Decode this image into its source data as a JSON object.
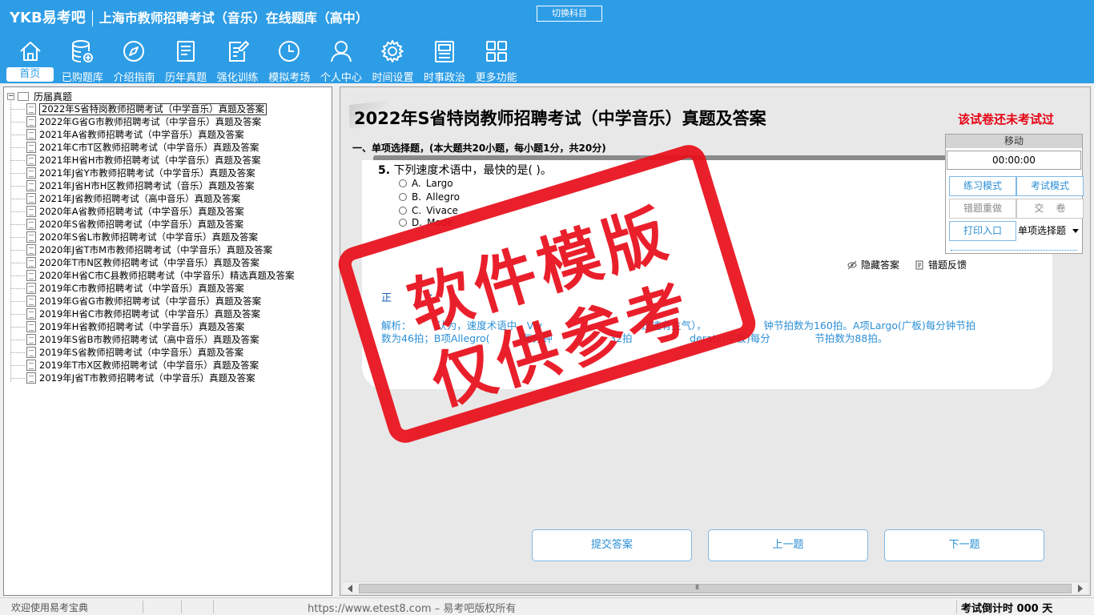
{
  "app": {
    "logo": "YKB易考吧",
    "title": "上海市教师招聘考试（音乐）在线题库（高中）",
    "switch_subject": "切换科目"
  },
  "nav": {
    "items": [
      {
        "label": "首页",
        "icon": "home-icon"
      },
      {
        "label": "已购题库",
        "icon": "database-icon"
      },
      {
        "label": "介绍指南",
        "icon": "compass-icon"
      },
      {
        "label": "历年真题",
        "icon": "document-list-icon"
      },
      {
        "label": "强化训练",
        "icon": "edit-document-icon"
      },
      {
        "label": "模拟考场",
        "icon": "clock-icon"
      },
      {
        "label": "个人中心",
        "icon": "user-icon"
      },
      {
        "label": "时间设置",
        "icon": "gear-icon"
      },
      {
        "label": "时事政治",
        "icon": "news-icon"
      },
      {
        "label": "更多功能",
        "icon": "grid-icon"
      }
    ]
  },
  "tree": {
    "root": "历届真题",
    "items": [
      "2022年S省特岗教师招聘考试（中学音乐）真题及答案",
      "2022年G省G市教师招聘考试（中学音乐）真题及答案",
      "2021年A省教师招聘考试（中学音乐）真题及答案",
      "2021年C市T区教师招聘考试（中学音乐）真题及答案",
      "2021年H省H市教师招聘考试（中学音乐）真题及答案",
      "2021年J省Y市教师招聘考试（中学音乐）真题及答案",
      "2021年J省H市H区教师招聘考试（音乐）真题及答案",
      "2021年J省教师招聘考试（高中音乐）真题及答案",
      "2020年A省教师招聘考试（中学音乐）真题及答案",
      "2020年S省教师招聘考试（中学音乐）真题及答案",
      "2020年S省L市教师招聘考试（中学音乐）真题及答案",
      "2020年J省T市M市教师招聘考试（中学音乐）真题及答案",
      "2020年T市N区教师招聘考试（中学音乐）真题及答案",
      "2020年H省C市C县教师招聘考试（中学音乐）精选真题及答案",
      "2019年C市教师招聘考试（中学音乐）真题及答案",
      "2019年G省G市教师招聘考试（中学音乐）真题及答案",
      "2019年H省C市教师招聘考试（中学音乐）真题及答案",
      "2019年H省教师招聘考试（中学音乐）真题及答案",
      "2019年S省B市教师招聘考试（高中音乐）真题及答案",
      "2019年S省教师招聘考试（中学音乐）真题及答案",
      "2019年T市X区教师招聘考试（中学音乐）真题及答案",
      "2019年J省T市教师招聘考试（中学音乐）真题及答案"
    ],
    "selected_index": 0
  },
  "paper": {
    "title": "2022年S省特岗教师招聘考试（中学音乐）真题及答案",
    "status": "该试卷还未考试过",
    "section": "一、单项选择题，(本大题共20小题，每小题1分，共20分)"
  },
  "question": {
    "number": "5.",
    "stem": "下列速度术语中，最快的是(  )。",
    "options": [
      {
        "letter": "A.",
        "text": "Largo"
      },
      {
        "letter": "B.",
        "text": "Allegro"
      },
      {
        "letter": "C.",
        "text": "Vivace"
      },
      {
        "letter": "D.",
        "text": "Mode"
      }
    ],
    "hide_answer": "隐藏答案",
    "error_feedback": "错题反馈",
    "answer_prefix": "正",
    "answer_suffix": "：",
    "analysis_line1": "解析：        认为，速度术语中，Viv              ，              迅速有生气），                  钟节拍数为160拍。A项Largo(广板)每分钟节拍",
    "analysis_line2": "数为46拍；B项Allegro(         )每分钟                  32拍                  derato(中板)每分              节拍数为88拍。"
  },
  "control": {
    "move": "移动",
    "timer": "00:00:00",
    "practice_mode": "练习模式",
    "exam_mode": "考试模式",
    "redo_wrong": "错题重做",
    "submit_paper": "交    卷",
    "print_entry": "打印入口",
    "question_type": "单项选择题"
  },
  "buttons": {
    "submit_answer": "提交答案",
    "prev": "上一题",
    "next": "下一题"
  },
  "scrollbar_grip": "III",
  "status": {
    "welcome": "欢迎使用易考宝典",
    "url": "https://www.etest8.com – 易考吧版权所有",
    "countdown": "考试倒计时 000 天"
  },
  "watermark": {
    "line1": "软件模版",
    "line2": "仅供参考"
  },
  "colors": {
    "header": "#2d9de6",
    "accent_blue": "#2b8fd6",
    "alert_red": "#e60012",
    "stamp_red": "#e8101b"
  }
}
